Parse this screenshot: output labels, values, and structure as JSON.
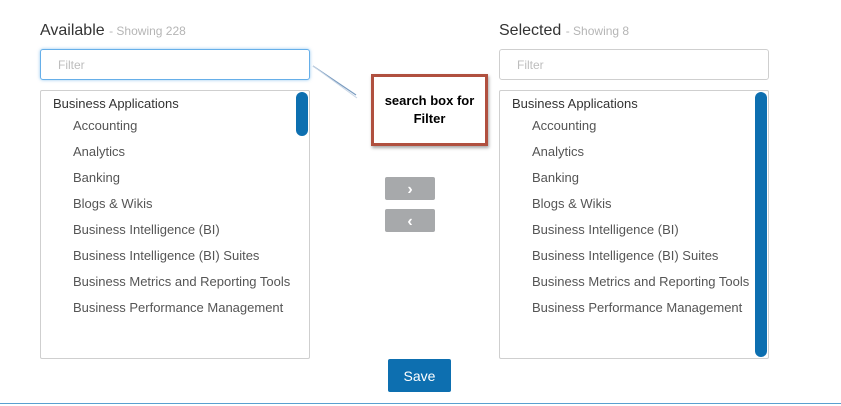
{
  "available": {
    "title": "Available",
    "count_text": "- Showing 228",
    "filter_placeholder": "Filter",
    "group": "Business Applications",
    "items": [
      "Accounting",
      "Analytics",
      "Banking",
      "Blogs & Wikis",
      "Business Intelligence (BI)",
      "Business Intelligence (BI) Suites",
      "Business Metrics and Reporting Tools",
      "Business Performance Management"
    ]
  },
  "selected": {
    "title": "Selected",
    "count_text": "- Showing 8",
    "filter_placeholder": "Filter",
    "group": "Business Applications",
    "items": [
      "Accounting",
      "Analytics",
      "Banking",
      "Blogs & Wikis",
      "Business Intelligence (BI)",
      "Business Intelligence (BI) Suites",
      "Business Metrics and Reporting Tools",
      "Business Performance Management"
    ]
  },
  "buttons": {
    "move_right": "›",
    "move_left": "‹",
    "save": "Save"
  },
  "callout": {
    "text": "search box for Filter"
  },
  "colors": {
    "accent": "#0d6fb0",
    "callout_border": "#b0503f",
    "focus": "#66afe9"
  }
}
